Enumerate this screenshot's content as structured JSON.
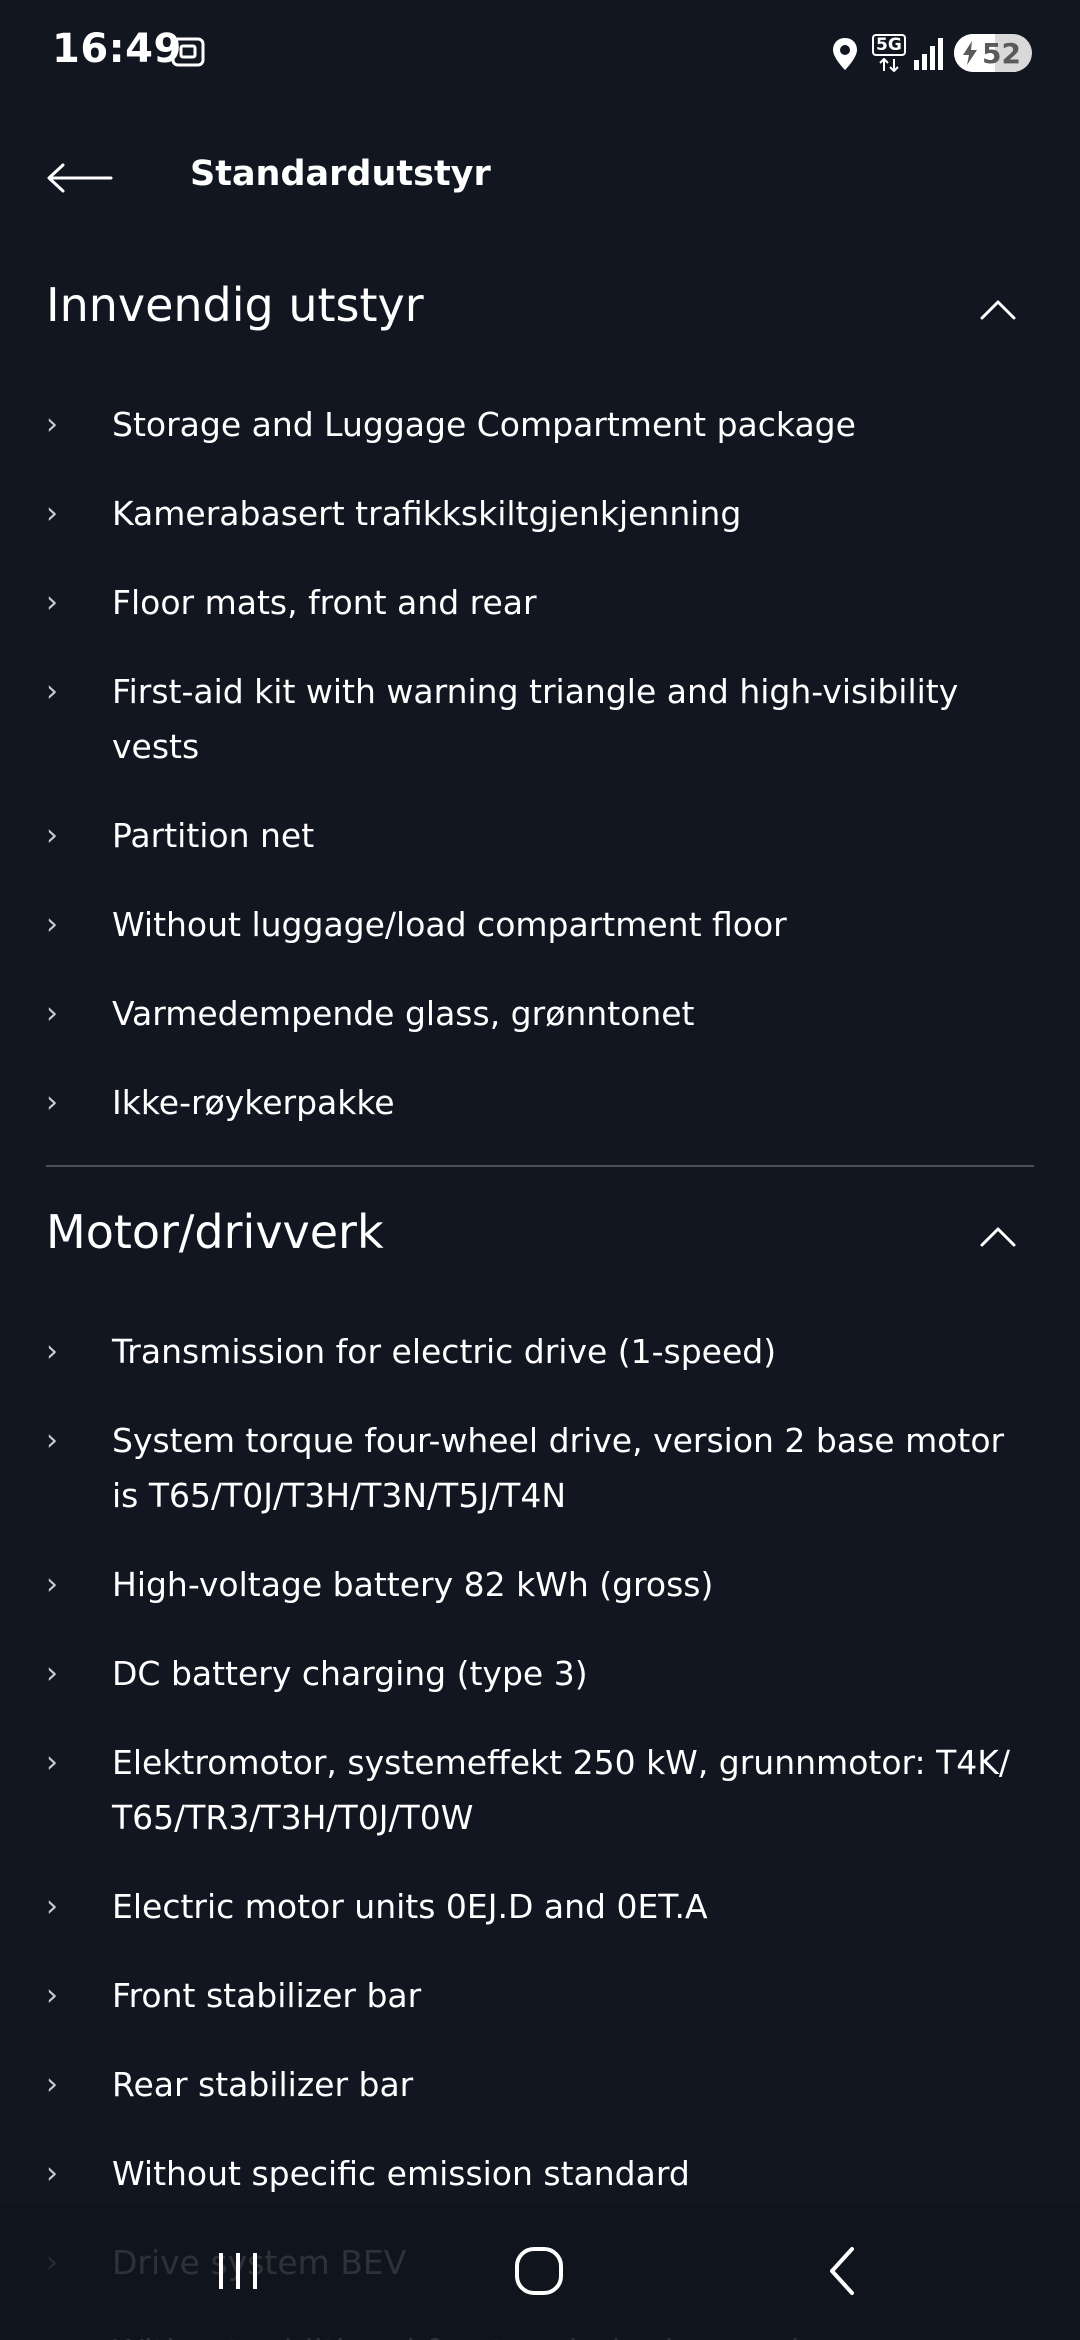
{
  "status_bar": {
    "time": "16:49",
    "network": "5G",
    "battery_level": "52",
    "icons": [
      "screenshot-icon",
      "location-icon",
      "signal-icon",
      "battery-charging-icon"
    ]
  },
  "header": {
    "back_icon": "arrow-left-icon",
    "title": "Standardutstyr"
  },
  "sections": [
    {
      "title": "Innvendig utstyr",
      "toggle_icon": "chevron-up-icon",
      "items": [
        "Storage and Luggage Compartment package",
        "Kamerabasert trafikkskiltgjenkjenning",
        "Floor mats, front and rear",
        "First-aid kit with warning triangle and high-visibility vests",
        "Partition net",
        "Without luggage/load compartment floor",
        "Varmedempende glass, grønntonet",
        "Ikke-røykerpakke"
      ]
    },
    {
      "title": "Motor/drivverk",
      "toggle_icon": "chevron-up-icon",
      "items": [
        "Transmission for electric drive (1-speed)",
        "System torque four-wheel drive, version 2 base motor is T65/T0J/T3H/T3N/T5J/T4N",
        "High-voltage battery 82 kWh (gross)",
        "DC battery charging (type 3)",
        "Elektromotor, systemeffekt 250 kW, grunnmotor: T4K/ T65/TR3/T3H/T0J/T0W",
        "Electric motor units 0EJ.D and 0ET.A",
        "Front stabilizer bar",
        "Rear stabilizer bar",
        "Without specific emission standard",
        "Drive system BEV",
        "Without additional front underbody guard"
      ]
    }
  ],
  "chevron_glyph": "›",
  "nav_bar": {
    "icons": [
      "recent-apps-icon",
      "home-icon",
      "back-icon"
    ]
  }
}
